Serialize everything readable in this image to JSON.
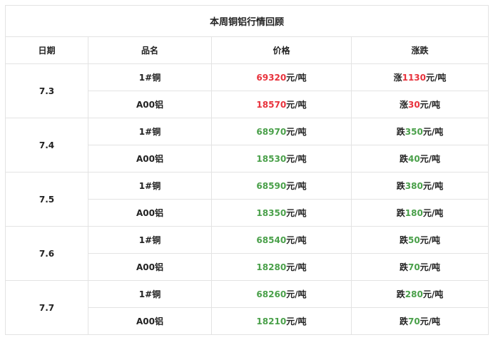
{
  "title": "本周铜铝行情回顾",
  "colors": {
    "up": "#e8323c",
    "down": "#4aa04a",
    "border": "#e3e3e3"
  },
  "headers": [
    "日期",
    "品名",
    "价格",
    "涨跌"
  ],
  "days": [
    {
      "date": "7.3",
      "rows": [
        {
          "product": "1#铜",
          "price": "69320",
          "price_unit": "元/吨",
          "trend": "up",
          "change_prefix": "涨",
          "change": "1130",
          "change_unit": "元/吨"
        },
        {
          "product": "A00铝",
          "price": "18570",
          "price_unit": "元/吨",
          "trend": "up",
          "change_prefix": "涨",
          "change": "30",
          "change_unit": "元/吨"
        }
      ]
    },
    {
      "date": "7.4",
      "rows": [
        {
          "product": "1#铜",
          "price": "68970",
          "price_unit": "元/吨",
          "trend": "down",
          "change_prefix": "跌",
          "change": "350",
          "change_unit": "元/吨"
        },
        {
          "product": "A00铝",
          "price": "18530",
          "price_unit": "元/吨",
          "trend": "down",
          "change_prefix": "跌",
          "change": "40",
          "change_unit": "元/吨"
        }
      ]
    },
    {
      "date": "7.5",
      "rows": [
        {
          "product": "1#铜",
          "price": "68590",
          "price_unit": "元/吨",
          "trend": "down",
          "change_prefix": "跌",
          "change": "380",
          "change_unit": "元/吨"
        },
        {
          "product": "A00铝",
          "price": "18350",
          "price_unit": "元/吨",
          "trend": "down",
          "change_prefix": "跌",
          "change": "180",
          "change_unit": "元/吨"
        }
      ]
    },
    {
      "date": "7.6",
      "rows": [
        {
          "product": "1#铜",
          "price": "68540",
          "price_unit": "元/吨",
          "trend": "down",
          "change_prefix": "跌",
          "change": "50",
          "change_unit": "元/吨"
        },
        {
          "product": "A00铝",
          "price": "18280",
          "price_unit": "元/吨",
          "trend": "down",
          "change_prefix": "跌",
          "change": "70",
          "change_unit": "元/吨"
        }
      ]
    },
    {
      "date": "7.7",
      "rows": [
        {
          "product": "1#铜",
          "price": "68260",
          "price_unit": "元/吨",
          "trend": "down",
          "change_prefix": "跌",
          "change": "280",
          "change_unit": "元/吨"
        },
        {
          "product": "A00铝",
          "price": "18210",
          "price_unit": "元/吨",
          "trend": "down",
          "change_prefix": "跌",
          "change": "70",
          "change_unit": "元/吨"
        }
      ]
    }
  ]
}
